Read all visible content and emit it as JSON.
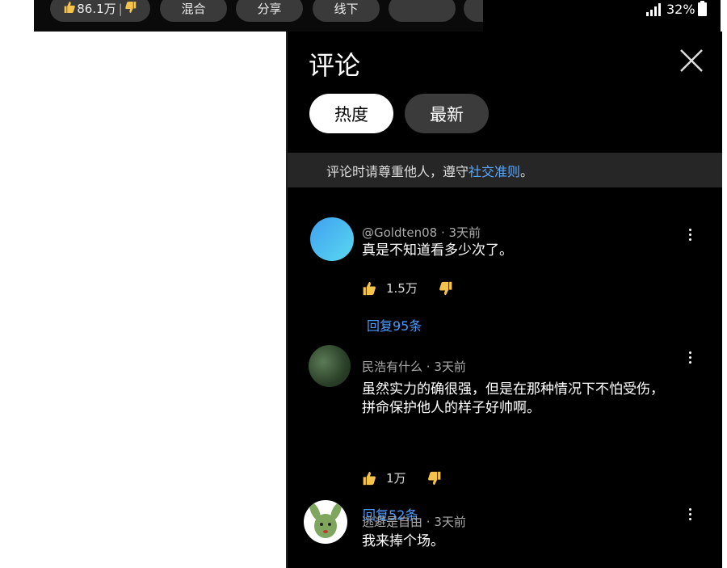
{
  "chips": [
    {
      "label": "86.1万"
    },
    {
      "label": "混合"
    },
    {
      "label": "分享"
    },
    {
      "label": "线下"
    },
    {
      "label": ""
    },
    {
      "label": ""
    }
  ],
  "status": {
    "battery": "32%"
  },
  "panel": {
    "title": "评论",
    "tabs": [
      {
        "label": "热度",
        "active": true
      },
      {
        "label": "最新",
        "active": false
      }
    ],
    "notice": {
      "prefix": "评论时请尊重他人，遵守",
      "link": "社交准则",
      "suffix": "。"
    }
  },
  "comments": [
    {
      "author": "@Goldten08",
      "time": "3天前",
      "lines": [
        "真是不知道看多少次了。"
      ],
      "likes": "1.5万",
      "reply": "回复95条"
    },
    {
      "author": "民浩有什么",
      "time": "3天前",
      "lines": [
        "虽然实力的确很强，但是在那种情况下不怕受伤，",
        "拼命保护他人的样子好帅啊。"
      ],
      "likes": "1万",
      "reply": "回复52条"
    },
    {
      "author": "逃避是自由",
      "time": "3天前",
      "lines": [
        "我来捧个场。"
      ]
    }
  ],
  "colors": {
    "link": "#5aa9ff",
    "reply": "#4a9bff",
    "thumb": "#f5c24c"
  }
}
